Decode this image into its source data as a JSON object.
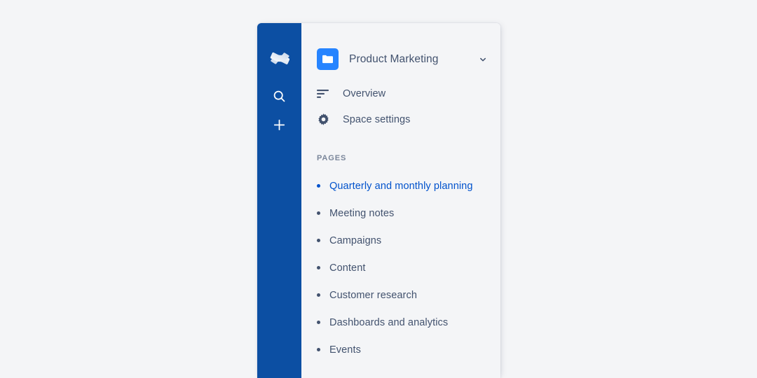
{
  "theme": {
    "page_background": "#f4f5f7",
    "rail_background": "#0c4fa3",
    "panel_background": "#f4f5f7",
    "accent_blue": "#0052cc",
    "avatar_blue": "#2684ff",
    "text_default": "#42526e",
    "text_subtle": "#7a869a"
  },
  "global_rail": {
    "items": [
      {
        "name": "confluence-logo",
        "icon": "confluence-logo-icon",
        "label": "Confluence"
      },
      {
        "name": "search",
        "icon": "search-icon",
        "label": "Search"
      },
      {
        "name": "create",
        "icon": "plus-icon",
        "label": "Create"
      }
    ]
  },
  "space_nav": {
    "header": {
      "avatar_icon": "space-folder-icon",
      "title": "Product Marketing",
      "chevron_icon": "chevron-down-icon"
    },
    "primary_links": [
      {
        "icon": "overview-lines-icon",
        "label": "Overview"
      },
      {
        "icon": "gear-icon",
        "label": "Space settings"
      }
    ],
    "pages": {
      "heading": "PAGES",
      "items": [
        {
          "label": "Quarterly and monthly planning",
          "active": true
        },
        {
          "label": "Meeting notes",
          "active": false
        },
        {
          "label": "Campaigns",
          "active": false
        },
        {
          "label": "Content",
          "active": false
        },
        {
          "label": "Customer research",
          "active": false
        },
        {
          "label": "Dashboards and analytics",
          "active": false
        },
        {
          "label": "Events",
          "active": false
        }
      ]
    }
  }
}
